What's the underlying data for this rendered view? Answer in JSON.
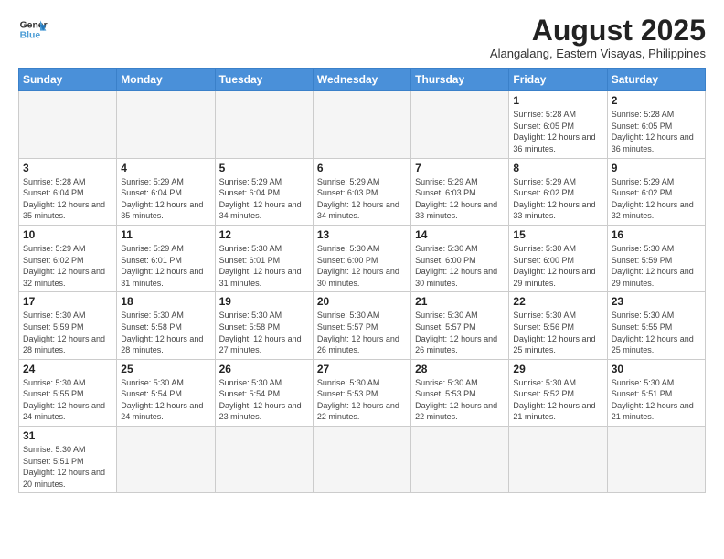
{
  "header": {
    "logo_general": "General",
    "logo_blue": "Blue",
    "month_year": "August 2025",
    "location": "Alangalang, Eastern Visayas, Philippines"
  },
  "days_of_week": [
    "Sunday",
    "Monday",
    "Tuesday",
    "Wednesday",
    "Thursday",
    "Friday",
    "Saturday"
  ],
  "weeks": [
    [
      {
        "day": "",
        "info": ""
      },
      {
        "day": "",
        "info": ""
      },
      {
        "day": "",
        "info": ""
      },
      {
        "day": "",
        "info": ""
      },
      {
        "day": "",
        "info": ""
      },
      {
        "day": "1",
        "info": "Sunrise: 5:28 AM\nSunset: 6:05 PM\nDaylight: 12 hours\nand 36 minutes."
      },
      {
        "day": "2",
        "info": "Sunrise: 5:28 AM\nSunset: 6:05 PM\nDaylight: 12 hours\nand 36 minutes."
      }
    ],
    [
      {
        "day": "3",
        "info": "Sunrise: 5:28 AM\nSunset: 6:04 PM\nDaylight: 12 hours\nand 35 minutes."
      },
      {
        "day": "4",
        "info": "Sunrise: 5:29 AM\nSunset: 6:04 PM\nDaylight: 12 hours\nand 35 minutes."
      },
      {
        "day": "5",
        "info": "Sunrise: 5:29 AM\nSunset: 6:04 PM\nDaylight: 12 hours\nand 34 minutes."
      },
      {
        "day": "6",
        "info": "Sunrise: 5:29 AM\nSunset: 6:03 PM\nDaylight: 12 hours\nand 34 minutes."
      },
      {
        "day": "7",
        "info": "Sunrise: 5:29 AM\nSunset: 6:03 PM\nDaylight: 12 hours\nand 33 minutes."
      },
      {
        "day": "8",
        "info": "Sunrise: 5:29 AM\nSunset: 6:02 PM\nDaylight: 12 hours\nand 33 minutes."
      },
      {
        "day": "9",
        "info": "Sunrise: 5:29 AM\nSunset: 6:02 PM\nDaylight: 12 hours\nand 32 minutes."
      }
    ],
    [
      {
        "day": "10",
        "info": "Sunrise: 5:29 AM\nSunset: 6:02 PM\nDaylight: 12 hours\nand 32 minutes."
      },
      {
        "day": "11",
        "info": "Sunrise: 5:29 AM\nSunset: 6:01 PM\nDaylight: 12 hours\nand 31 minutes."
      },
      {
        "day": "12",
        "info": "Sunrise: 5:30 AM\nSunset: 6:01 PM\nDaylight: 12 hours\nand 31 minutes."
      },
      {
        "day": "13",
        "info": "Sunrise: 5:30 AM\nSunset: 6:00 PM\nDaylight: 12 hours\nand 30 minutes."
      },
      {
        "day": "14",
        "info": "Sunrise: 5:30 AM\nSunset: 6:00 PM\nDaylight: 12 hours\nand 30 minutes."
      },
      {
        "day": "15",
        "info": "Sunrise: 5:30 AM\nSunset: 6:00 PM\nDaylight: 12 hours\nand 29 minutes."
      },
      {
        "day": "16",
        "info": "Sunrise: 5:30 AM\nSunset: 5:59 PM\nDaylight: 12 hours\nand 29 minutes."
      }
    ],
    [
      {
        "day": "17",
        "info": "Sunrise: 5:30 AM\nSunset: 5:59 PM\nDaylight: 12 hours\nand 28 minutes."
      },
      {
        "day": "18",
        "info": "Sunrise: 5:30 AM\nSunset: 5:58 PM\nDaylight: 12 hours\nand 28 minutes."
      },
      {
        "day": "19",
        "info": "Sunrise: 5:30 AM\nSunset: 5:58 PM\nDaylight: 12 hours\nand 27 minutes."
      },
      {
        "day": "20",
        "info": "Sunrise: 5:30 AM\nSunset: 5:57 PM\nDaylight: 12 hours\nand 26 minutes."
      },
      {
        "day": "21",
        "info": "Sunrise: 5:30 AM\nSunset: 5:57 PM\nDaylight: 12 hours\nand 26 minutes."
      },
      {
        "day": "22",
        "info": "Sunrise: 5:30 AM\nSunset: 5:56 PM\nDaylight: 12 hours\nand 25 minutes."
      },
      {
        "day": "23",
        "info": "Sunrise: 5:30 AM\nSunset: 5:55 PM\nDaylight: 12 hours\nand 25 minutes."
      }
    ],
    [
      {
        "day": "24",
        "info": "Sunrise: 5:30 AM\nSunset: 5:55 PM\nDaylight: 12 hours\nand 24 minutes."
      },
      {
        "day": "25",
        "info": "Sunrise: 5:30 AM\nSunset: 5:54 PM\nDaylight: 12 hours\nand 24 minutes."
      },
      {
        "day": "26",
        "info": "Sunrise: 5:30 AM\nSunset: 5:54 PM\nDaylight: 12 hours\nand 23 minutes."
      },
      {
        "day": "27",
        "info": "Sunrise: 5:30 AM\nSunset: 5:53 PM\nDaylight: 12 hours\nand 22 minutes."
      },
      {
        "day": "28",
        "info": "Sunrise: 5:30 AM\nSunset: 5:53 PM\nDaylight: 12 hours\nand 22 minutes."
      },
      {
        "day": "29",
        "info": "Sunrise: 5:30 AM\nSunset: 5:52 PM\nDaylight: 12 hours\nand 21 minutes."
      },
      {
        "day": "30",
        "info": "Sunrise: 5:30 AM\nSunset: 5:51 PM\nDaylight: 12 hours\nand 21 minutes."
      }
    ],
    [
      {
        "day": "31",
        "info": "Sunrise: 5:30 AM\nSunset: 5:51 PM\nDaylight: 12 hours\nand 20 minutes."
      },
      {
        "day": "",
        "info": ""
      },
      {
        "day": "",
        "info": ""
      },
      {
        "day": "",
        "info": ""
      },
      {
        "day": "",
        "info": ""
      },
      {
        "day": "",
        "info": ""
      },
      {
        "day": "",
        "info": ""
      }
    ]
  ]
}
